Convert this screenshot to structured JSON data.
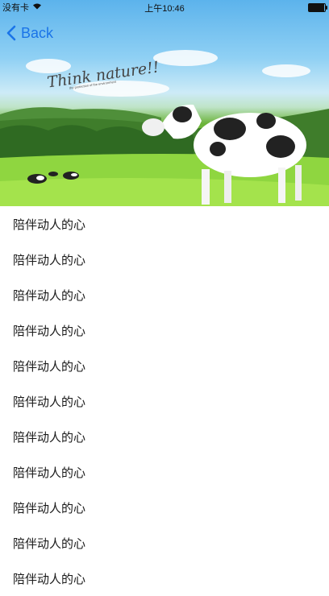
{
  "status": {
    "carrier": "没有卡",
    "time": "上午10:46"
  },
  "nav": {
    "back_label": "Back"
  },
  "hero": {
    "title": "Think nature!!",
    "caption": "the protection of the environment"
  },
  "list": [
    {
      "label": "陪伴动人的心"
    },
    {
      "label": "陪伴动人的心"
    },
    {
      "label": "陪伴动人的心"
    },
    {
      "label": "陪伴动人的心"
    },
    {
      "label": "陪伴动人的心"
    },
    {
      "label": "陪伴动人的心"
    },
    {
      "label": "陪伴动人的心"
    },
    {
      "label": "陪伴动人的心"
    },
    {
      "label": "陪伴动人的心"
    },
    {
      "label": "陪伴动人的心"
    },
    {
      "label": "陪伴动人的心"
    }
  ]
}
